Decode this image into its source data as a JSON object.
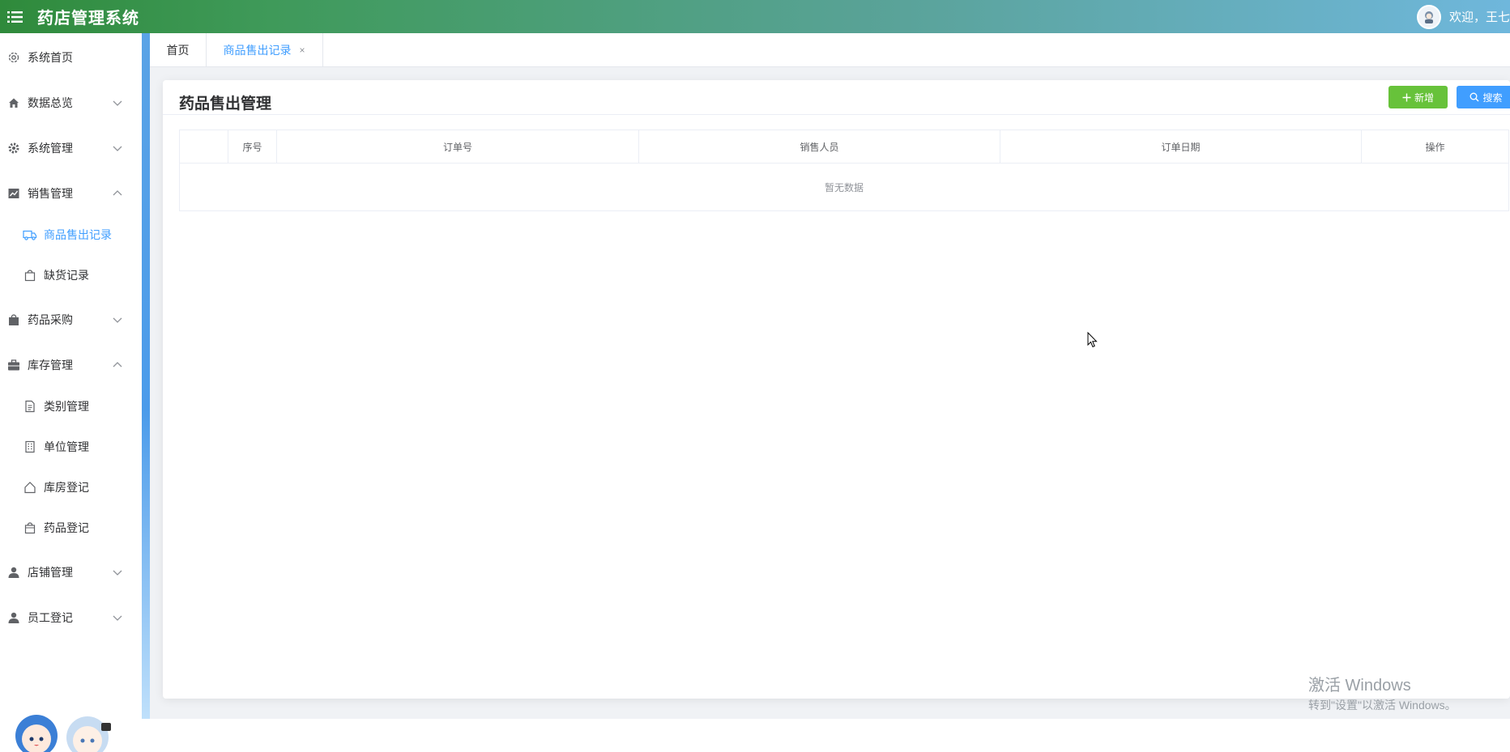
{
  "header": {
    "title": "药店管理系统",
    "welcome": "欢迎，王七"
  },
  "sidebar": {
    "items": [
      {
        "label": "系统首页",
        "icon": "gear-outline-icon"
      },
      {
        "label": "数据总览",
        "icon": "home-icon"
      },
      {
        "label": "系统管理",
        "icon": "settings-icon"
      },
      {
        "label": "销售管理",
        "icon": "chart-icon"
      },
      {
        "label": "药品采购",
        "icon": "bag-icon"
      },
      {
        "label": "库存管理",
        "icon": "briefcase-icon"
      },
      {
        "label": "店铺管理",
        "icon": "user-icon"
      },
      {
        "label": "员工登记",
        "icon": "user-icon"
      }
    ],
    "sales_sub": [
      {
        "label": "商品售出记录",
        "icon": "truck-icon"
      },
      {
        "label": "缺货记录",
        "icon": "shopping-bag-icon"
      }
    ],
    "inventory_sub": [
      {
        "label": "类别管理",
        "icon": "document-icon"
      },
      {
        "label": "单位管理",
        "icon": "building-icon"
      },
      {
        "label": "库房登记",
        "icon": "house-icon"
      },
      {
        "label": "药品登记",
        "icon": "bag-icon"
      }
    ]
  },
  "tabs": {
    "home": "首页",
    "active": "商品售出记录",
    "close": "×"
  },
  "content": {
    "title": "药品售出管理",
    "add_button": "新增",
    "search_button": "搜索",
    "columns": [
      "",
      "序号",
      "订单号",
      "销售人员",
      "订单日期",
      "操作"
    ],
    "empty_text": "暂无数据"
  },
  "watermark": {
    "line1": "激活 Windows",
    "line2": "转到\"设置\"以激活 Windows。"
  },
  "colors": {
    "accent": "#409eff",
    "success": "#67c23a",
    "header_start": "#2f8a3b",
    "header_end": "#6fb7dc"
  }
}
